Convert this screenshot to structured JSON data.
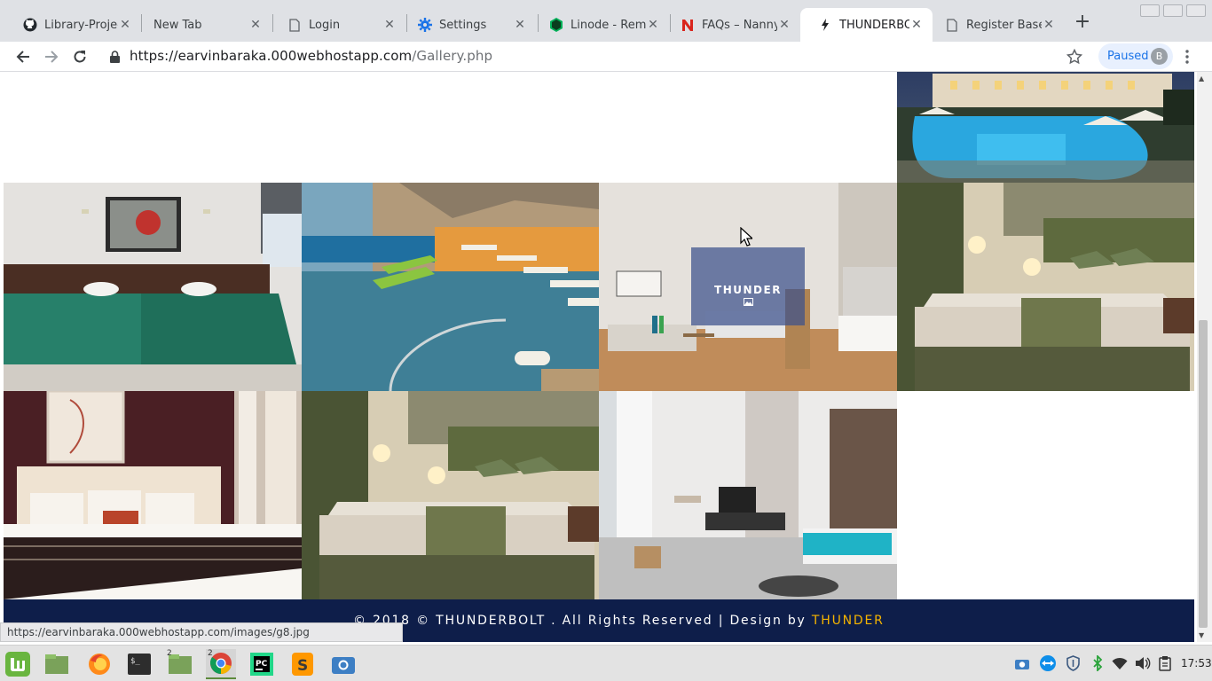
{
  "browser": {
    "tabs": [
      {
        "title": "Library-Project",
        "icon": "github-icon",
        "active": false
      },
      {
        "title": "New Tab",
        "icon": "none",
        "active": false
      },
      {
        "title": "Login",
        "icon": "page-icon",
        "active": false
      },
      {
        "title": "Settings",
        "icon": "gear-icon",
        "active": false
      },
      {
        "title": "Linode - Remote",
        "icon": "linode-icon",
        "active": false
      },
      {
        "title": "FAQs – Nanny S",
        "icon": "n-logo-icon",
        "active": false
      },
      {
        "title": "THUNDERBOLT",
        "icon": "bolt-icon",
        "active": true
      },
      {
        "title": "Register Base",
        "icon": "page-icon",
        "active": false
      }
    ],
    "url_host": "https://earvinbaraka.000webhostapp.com",
    "url_path": "/Gallery.php",
    "profile_status": "Paused",
    "profile_initial": "B",
    "status_bar_url": "https://earvinbaraka.000webhostapp.com/images/g8.jpg"
  },
  "gallery": {
    "overlay_title": "THUNDER",
    "tiles": [
      {
        "subject": "pool-resort-night"
      },
      {
        "subject": "twin-bed-room"
      },
      {
        "subject": "infinity-pool-loungers"
      },
      {
        "subject": "hotel-room-desk"
      },
      {
        "subject": "double-bed-room-olive"
      },
      {
        "subject": "bed-room-dark-wood"
      },
      {
        "subject": "double-bed-room-olive-2"
      },
      {
        "subject": "studio-room-tv"
      }
    ]
  },
  "footer": {
    "text": "© 2018 © THUNDERBOLT . All Rights Reserved | Design by ",
    "designer": "THUNDER"
  },
  "taskbar": {
    "clock": "17:53",
    "chrome_badge": "2",
    "files_badge": "2"
  },
  "colors": {
    "footer_bg": "#0e1e4a",
    "footer_accent": "#f5b400",
    "overlay_bg": "#3c508c"
  }
}
